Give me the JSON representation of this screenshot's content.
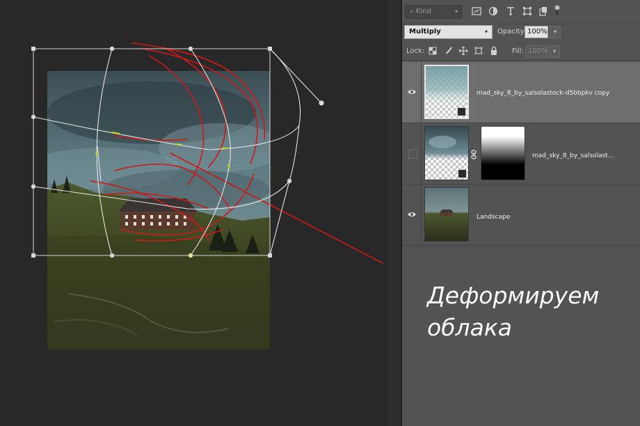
{
  "layers_panel": {
    "filter": {
      "kind_label": "Kind"
    },
    "blend_mode": "Multiply",
    "opacity": {
      "label": "Opacity:",
      "value": "100%"
    },
    "lock": {
      "label": "Lock:"
    },
    "fill": {
      "label": "Fill:",
      "value": "100%"
    },
    "layers": [
      {
        "name": "mad_sky_8_by_salsolastock-d5bbpkv copy",
        "visible": true,
        "selected": true
      },
      {
        "name": "mad_sky_8_by_salsolast...",
        "visible": false,
        "selected": false,
        "has_mask": true
      },
      {
        "name": "Landscape",
        "visible": true,
        "selected": false
      }
    ]
  },
  "caption": {
    "line1": "Деформируем",
    "line2": "облака"
  },
  "colors": {
    "panel": "#535353",
    "canvas": "#282828",
    "selected_row": "#6e6e6e",
    "annotation": "#d01818"
  }
}
